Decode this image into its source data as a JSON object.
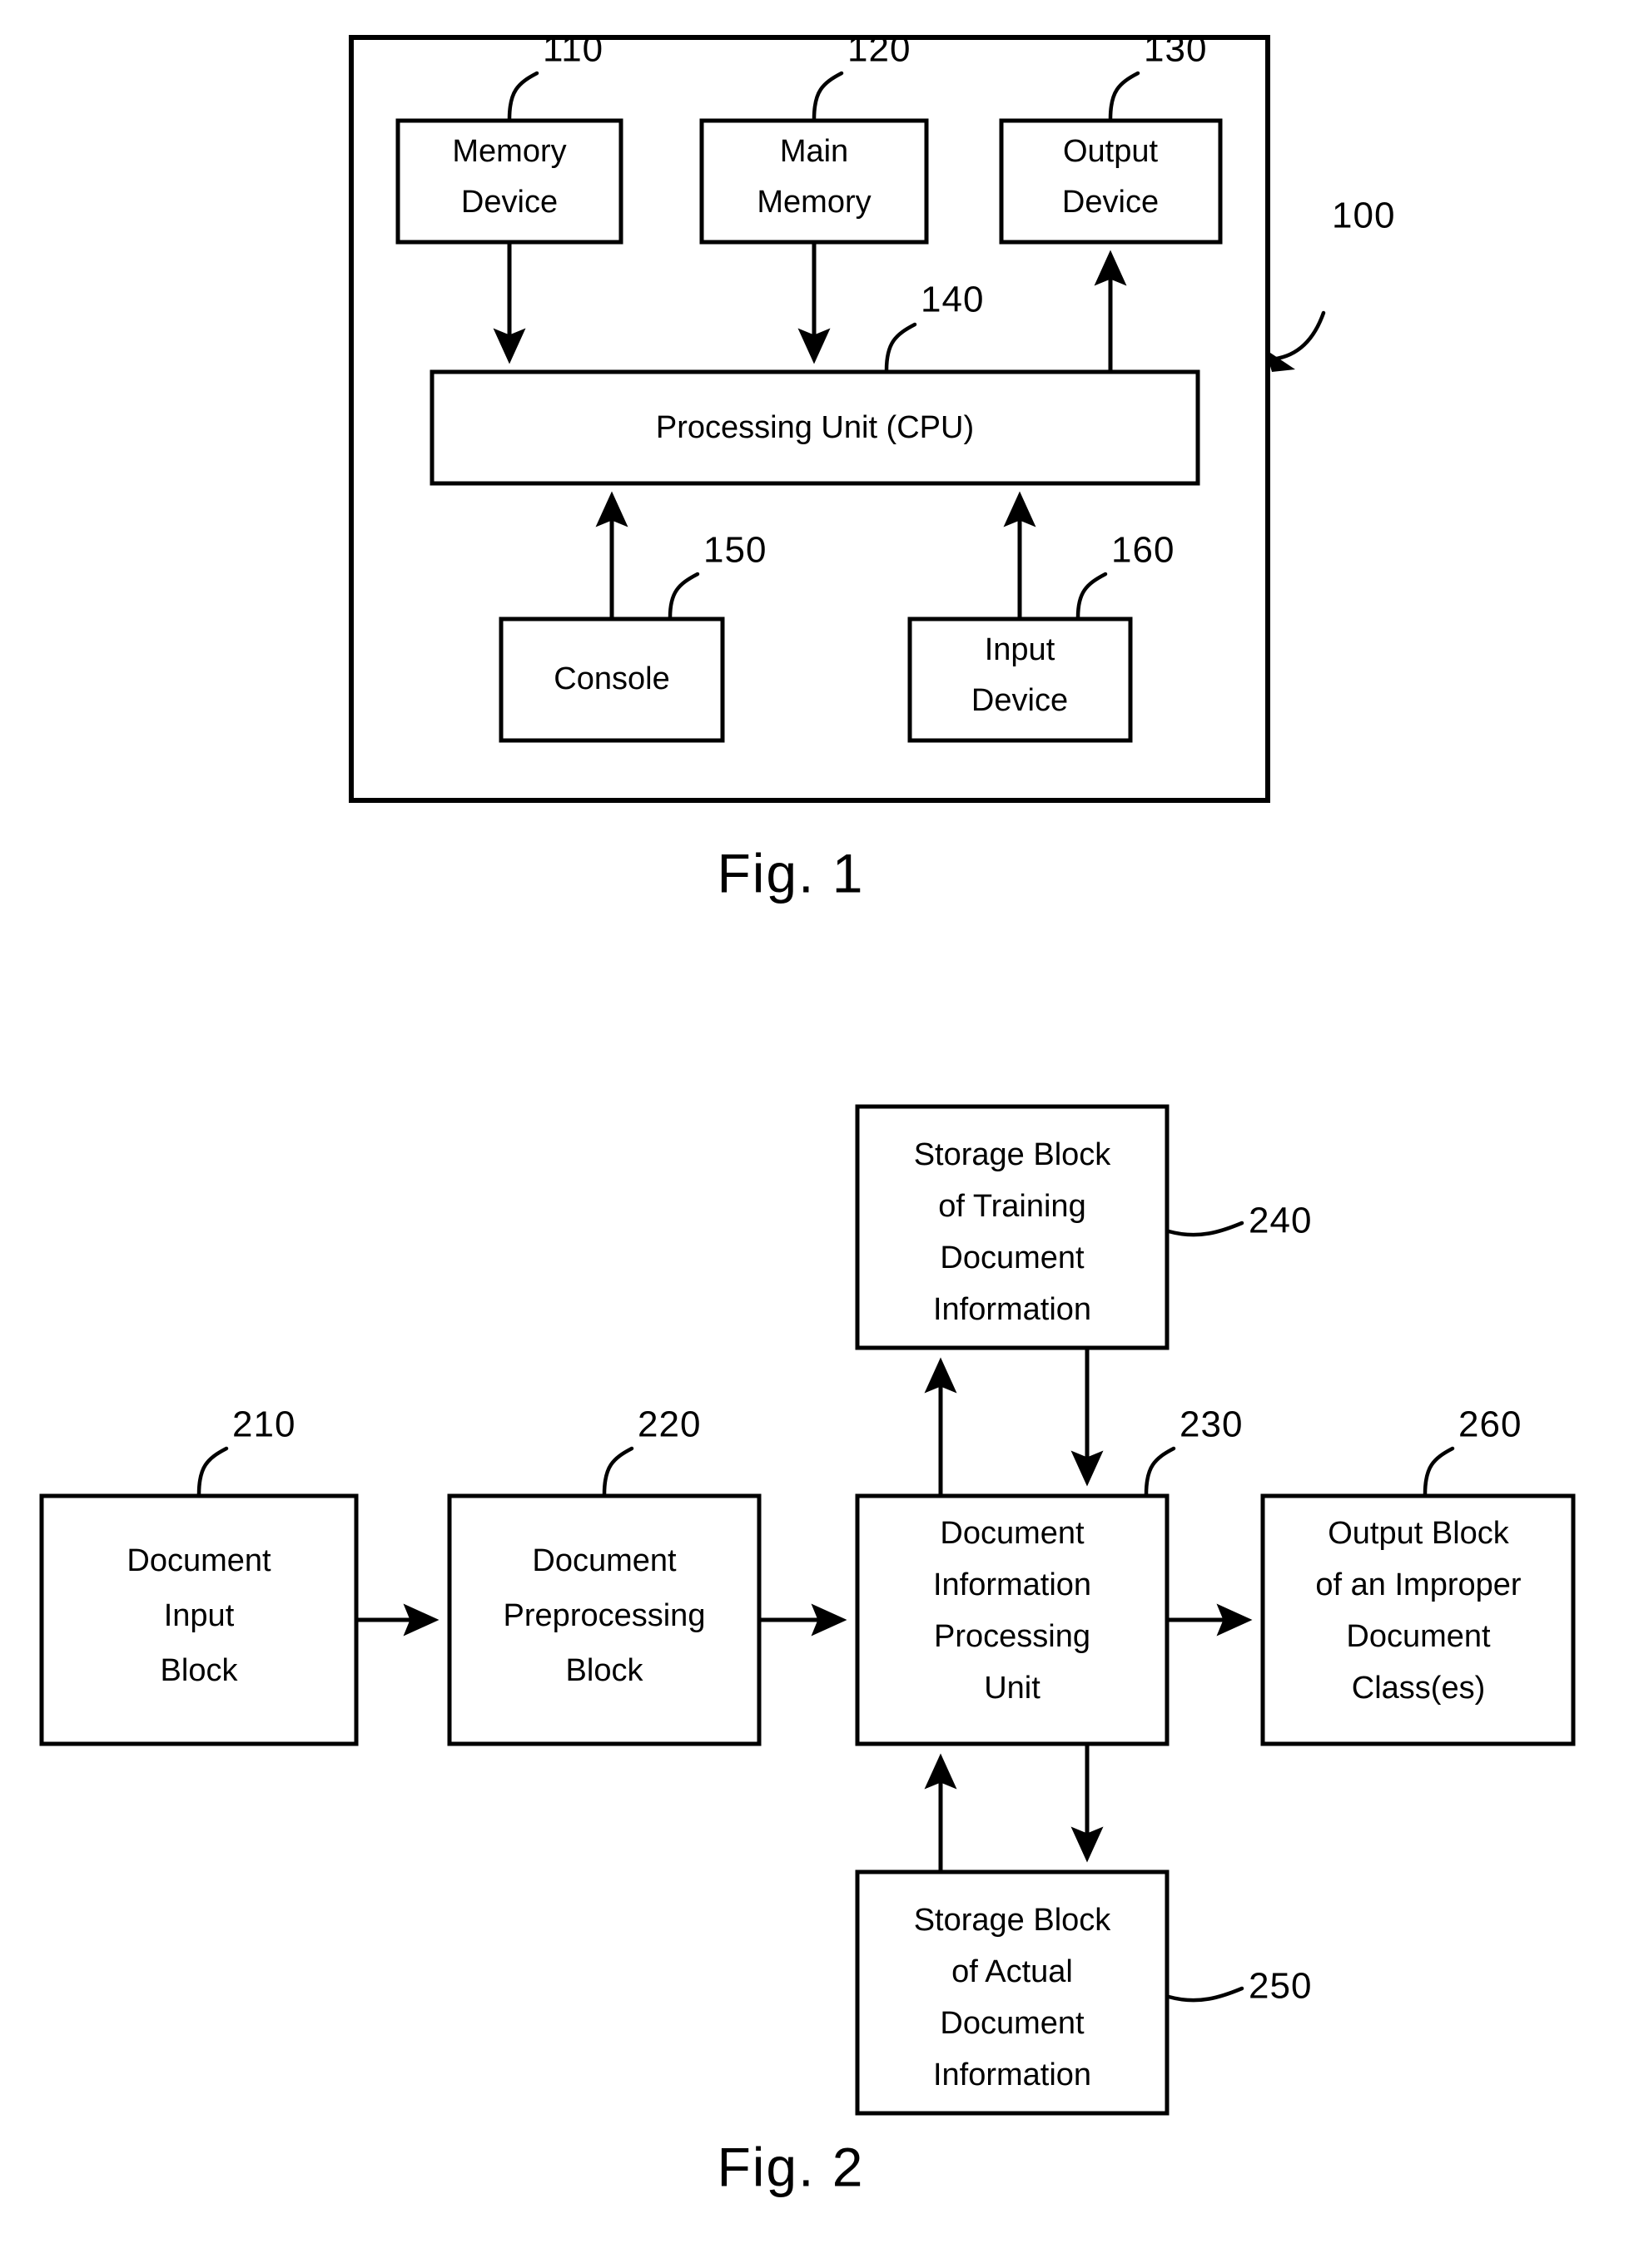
{
  "document": {
    "type": "patent-drawing-sheet",
    "background_color": "#ffffff",
    "line_color": "#000000"
  },
  "figures": [
    {
      "id": "fig1",
      "caption": "Fig. 1",
      "system_ref": "100",
      "blocks": [
        {
          "ref": "110",
          "lines": [
            "Memory",
            "Device"
          ]
        },
        {
          "ref": "120",
          "lines": [
            "Main",
            "Memory"
          ]
        },
        {
          "ref": "130",
          "lines": [
            "Output",
            "Device"
          ]
        },
        {
          "ref": "140",
          "lines": [
            "Processing Unit (CPU)"
          ]
        },
        {
          "ref": "150",
          "lines": [
            "Console"
          ]
        },
        {
          "ref": "160",
          "lines": [
            "Input",
            "Device"
          ]
        }
      ]
    },
    {
      "id": "fig2",
      "caption": "Fig. 2",
      "blocks": [
        {
          "ref": "210",
          "lines": [
            "Document",
            "Input",
            "Block"
          ]
        },
        {
          "ref": "220",
          "lines": [
            "Document",
            "Preprocessing",
            "Block"
          ]
        },
        {
          "ref": "230",
          "lines": [
            "Document",
            "Information",
            "Processing",
            "Unit"
          ]
        },
        {
          "ref": "240",
          "lines": [
            "Storage Block",
            "of Training",
            "Document",
            "Information"
          ]
        },
        {
          "ref": "250",
          "lines": [
            "Storage Block",
            "of Actual",
            "Document",
            "Information"
          ]
        },
        {
          "ref": "260",
          "lines": [
            "Output Block",
            "of an Improper",
            "Document",
            "Class(es)"
          ]
        }
      ]
    }
  ],
  "fig1": {
    "caption": "Fig. 1",
    "ref_100": "100",
    "memory_device": {
      "ref": "110",
      "line1": "Memory",
      "line2": "Device"
    },
    "main_memory": {
      "ref": "120",
      "line1": "Main",
      "line2": "Memory"
    },
    "output_device": {
      "ref": "130",
      "line1": "Output",
      "line2": "Device"
    },
    "cpu": {
      "ref": "140",
      "label": "Processing Unit (CPU)"
    },
    "console": {
      "ref": "150",
      "label": "Console"
    },
    "input_device": {
      "ref": "160",
      "line1": "Input",
      "line2": "Device"
    }
  },
  "fig2": {
    "caption": "Fig. 2",
    "document_input_block": {
      "ref": "210",
      "line1": "Document",
      "line2": "Input",
      "line3": "Block"
    },
    "document_preprocessing_block": {
      "ref": "220",
      "line1": "Document",
      "line2": "Preprocessing",
      "line3": "Block"
    },
    "document_information_processing_unit": {
      "ref": "230",
      "line1": "Document",
      "line2": "Information",
      "line3": "Processing",
      "line4": "Unit"
    },
    "training_storage_block": {
      "ref": "240",
      "line1": "Storage Block",
      "line2": "of Training",
      "line3": "Document",
      "line4": "Information"
    },
    "actual_storage_block": {
      "ref": "250",
      "line1": "Storage Block",
      "line2": "of Actual",
      "line3": "Document",
      "line4": "Information"
    },
    "output_block": {
      "ref": "260",
      "line1": "Output Block",
      "line2": "of an Improper",
      "line3": "Document",
      "line4": "Class(es)"
    }
  }
}
